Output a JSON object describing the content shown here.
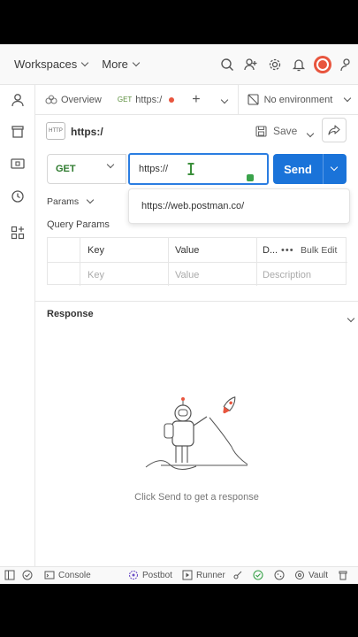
{
  "header": {
    "workspaces_label": "Workspaces",
    "more_label": "More"
  },
  "tabs": {
    "overview_label": "Overview",
    "active_method": "GET",
    "active_label": "https:/",
    "environment_label": "No environment"
  },
  "request": {
    "title": "https:/",
    "save_label": "Save",
    "method": "GET",
    "url_value": "https://",
    "send_label": "Send",
    "suggestion": "https://web.postman.co/"
  },
  "params": {
    "tab_label": "Params",
    "section_title": "Query Params",
    "columns": {
      "key": "Key",
      "value": "Value",
      "description": "D..."
    },
    "bulk_edit_label": "Bulk Edit",
    "placeholders": {
      "key": "Key",
      "value": "Value",
      "description": "Description"
    }
  },
  "response": {
    "title": "Response",
    "hint": "Click Send to get a response"
  },
  "statusbar": {
    "console_label": "Console",
    "postbot_label": "Postbot",
    "runner_label": "Runner",
    "vault_label": "Vault"
  },
  "colors": {
    "accent": "#1a73d9",
    "get_method": "#2d7a2d",
    "brand_orange": "#e8553e"
  }
}
